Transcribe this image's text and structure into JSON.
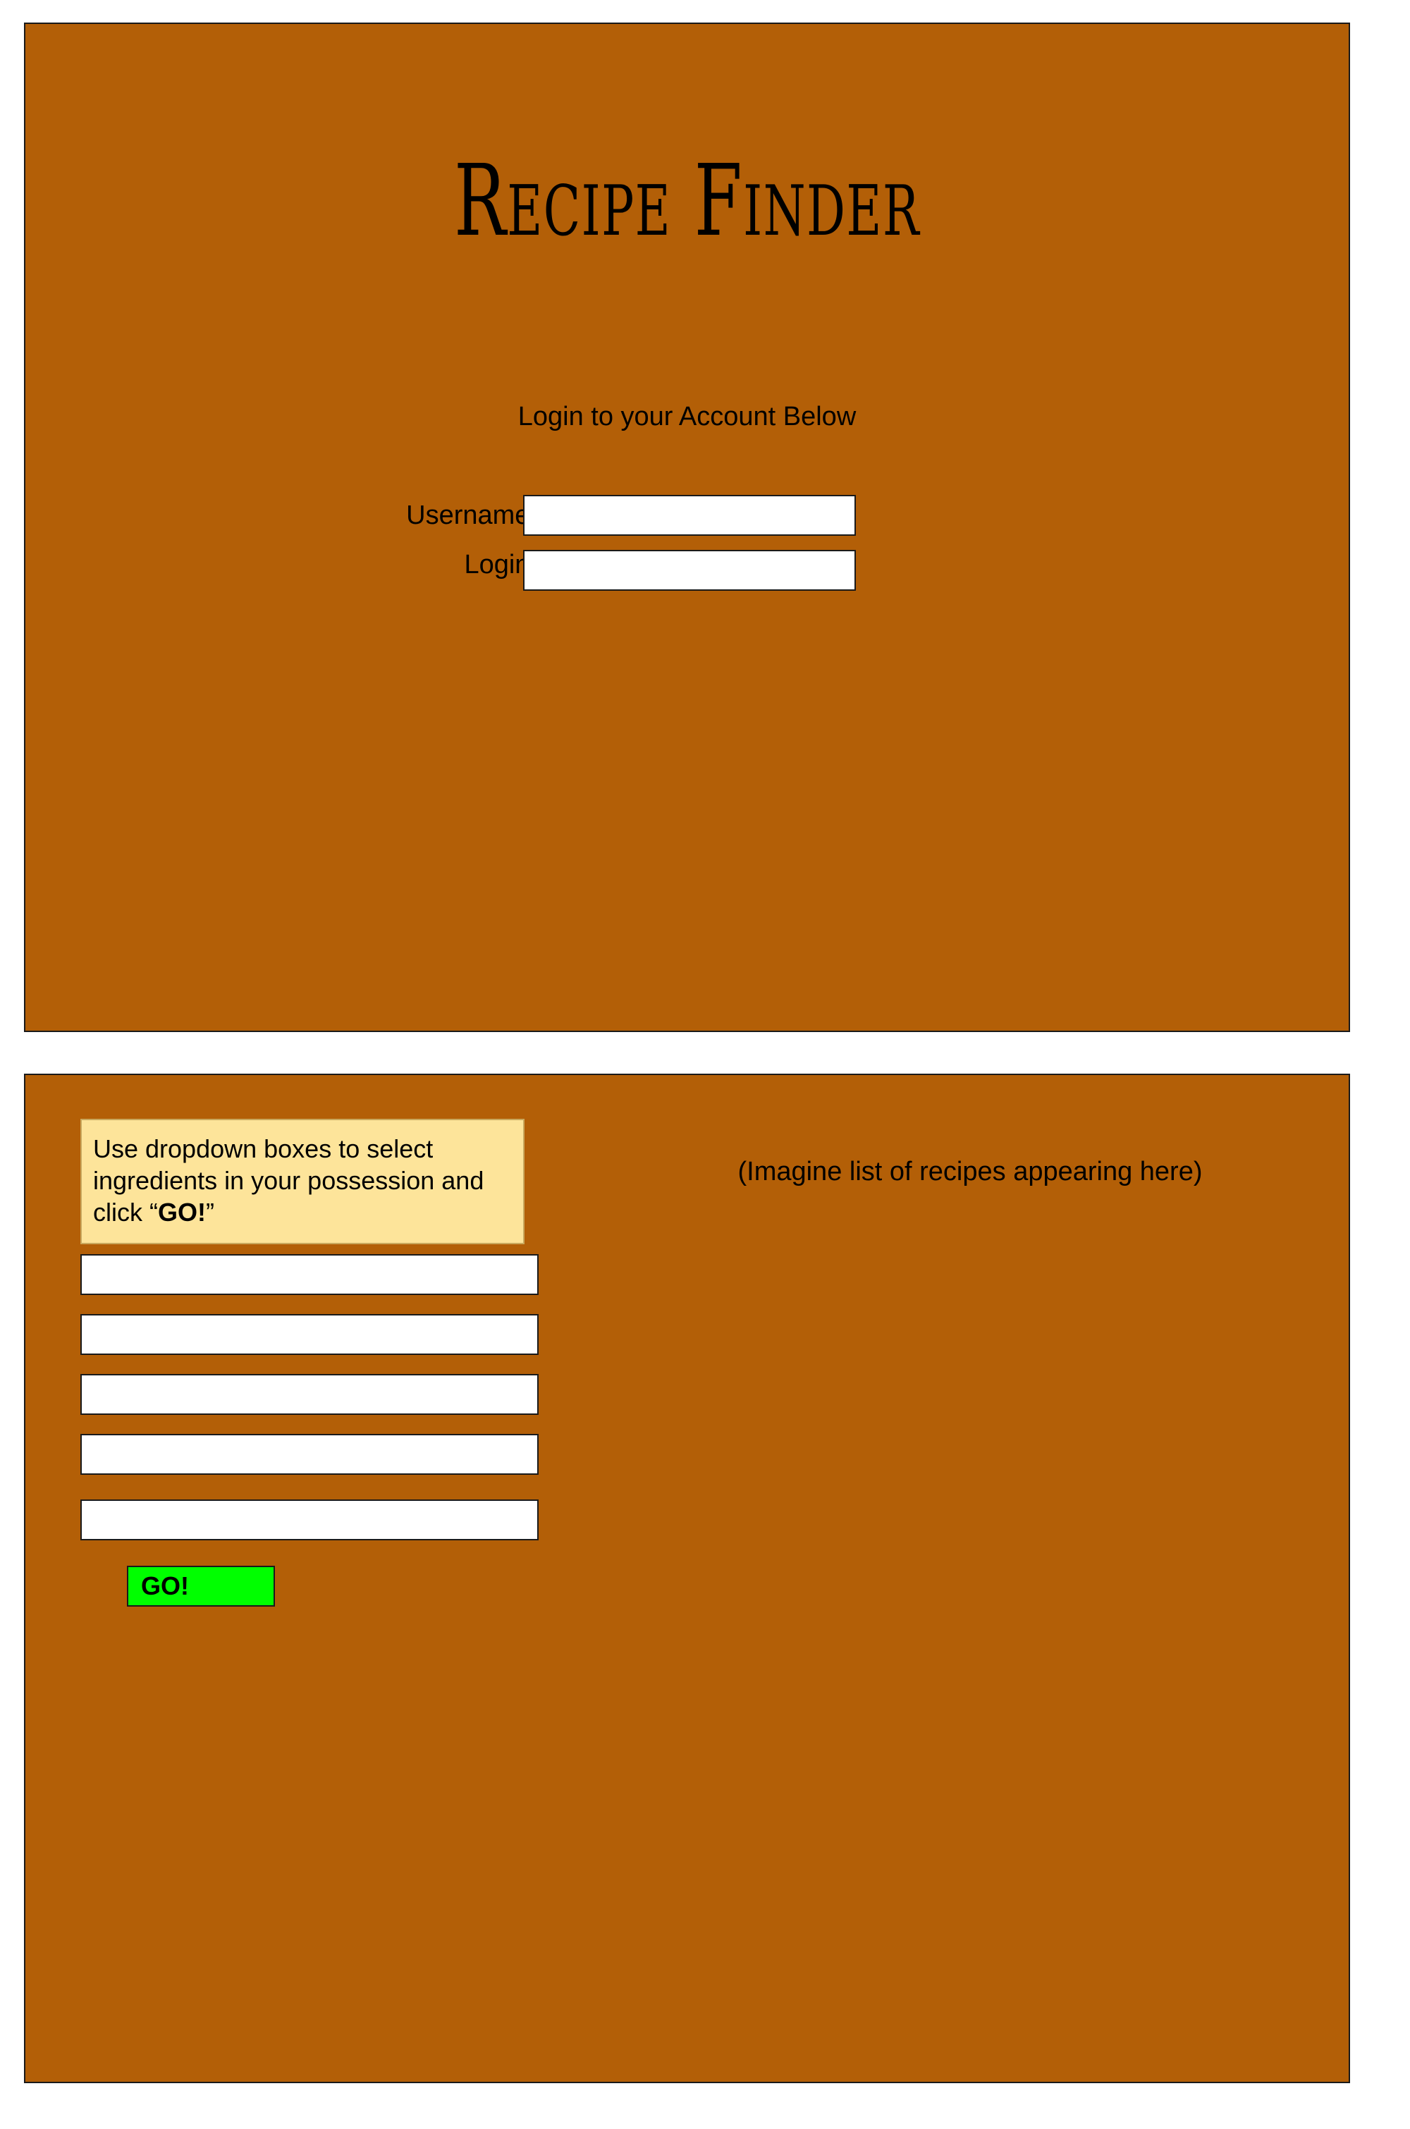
{
  "login": {
    "title": "Recipe Finder",
    "prompt": "Login to your Account Below",
    "username_label": "Username:",
    "username_value": "",
    "login_label": "Login:",
    "login_value": ""
  },
  "finder": {
    "instructions_pre": "Use dropdown boxes to select ingredients in your possession and click “",
    "instructions_bold": "GO!",
    "instructions_post": "”",
    "recipes_placeholder": "(Imagine list of recipes appearing here)",
    "dropdowns": [
      "",
      "",
      "",
      "",
      ""
    ],
    "go_label": "GO!"
  },
  "colors": {
    "panel": "#b35f07",
    "instructions_bg": "#fde49a",
    "go_button": "#00ff00"
  }
}
